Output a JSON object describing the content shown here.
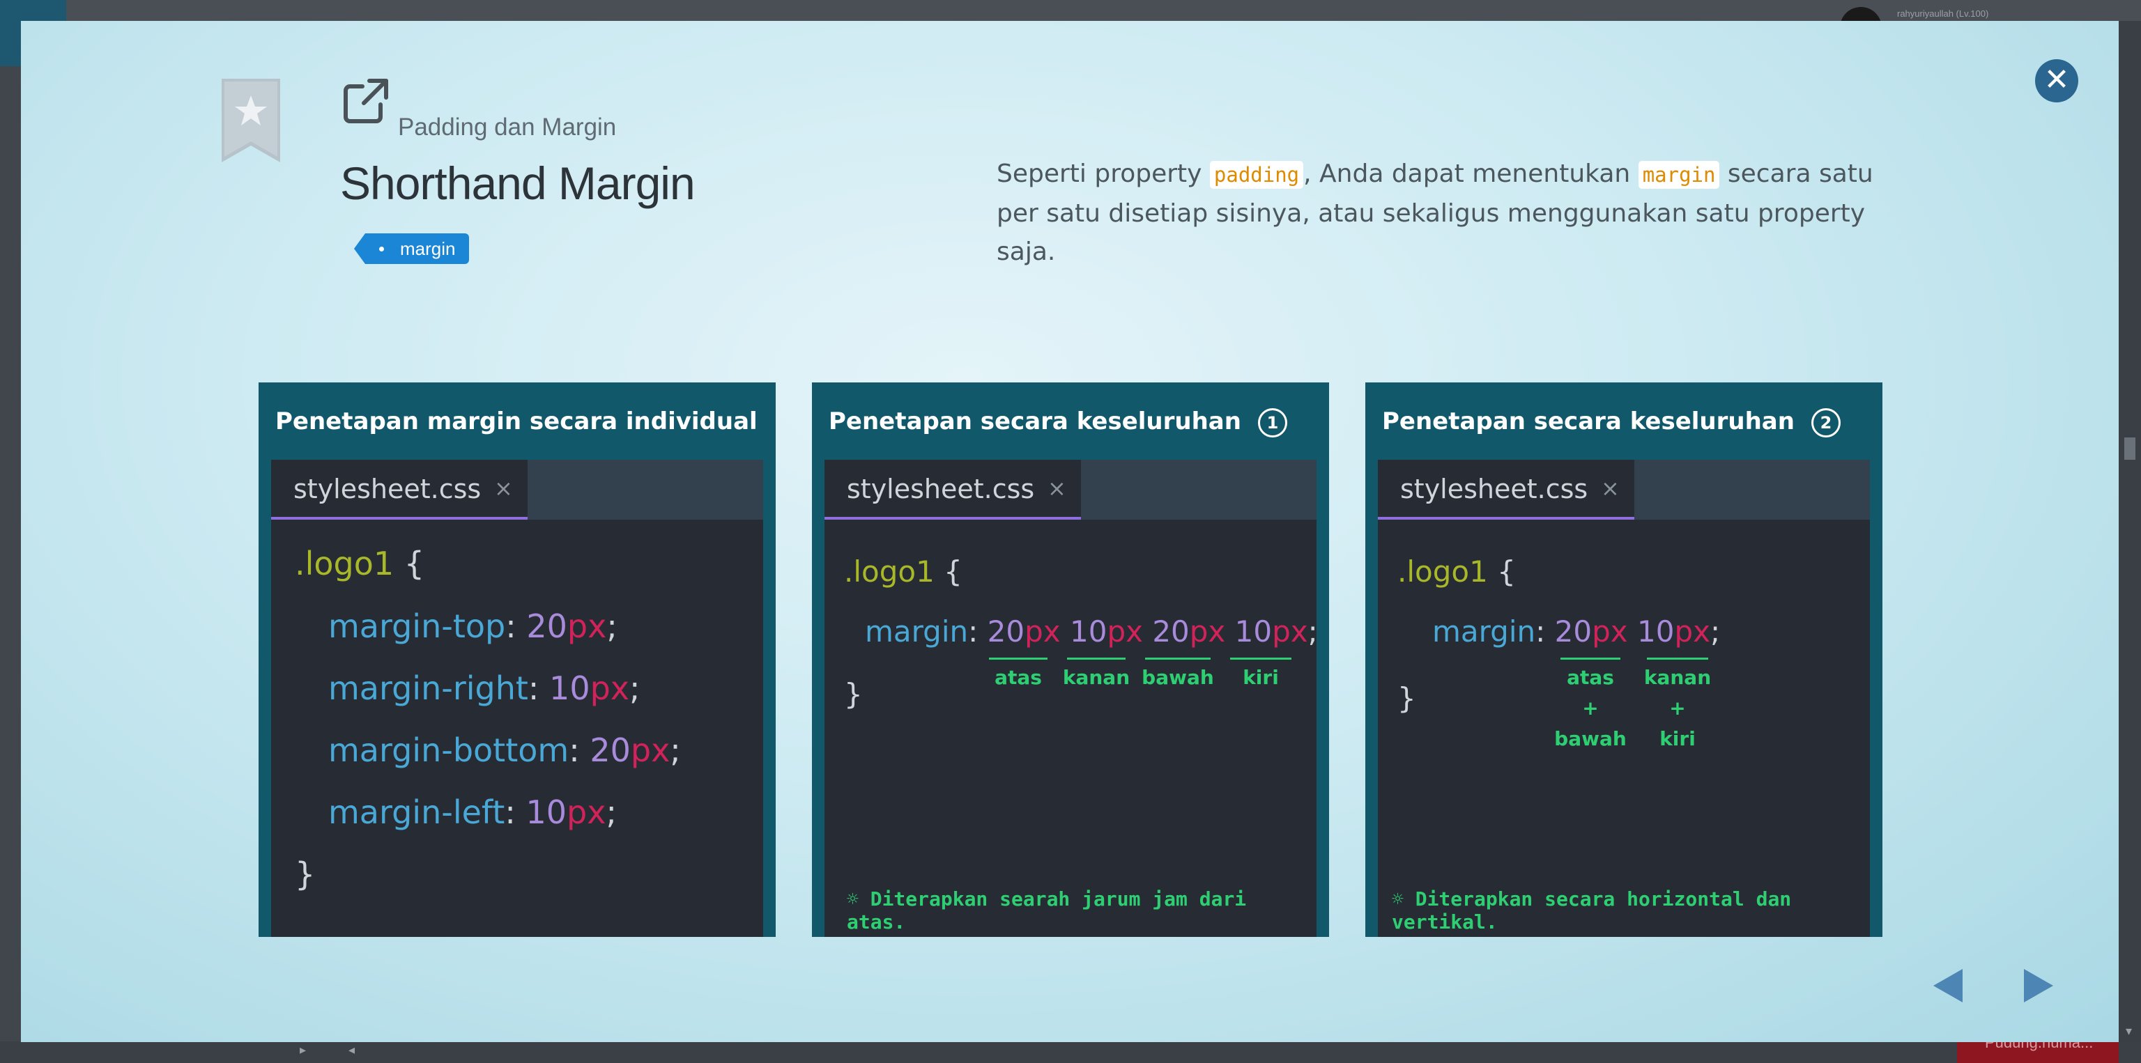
{
  "background": {
    "username": "rahyuriyaullah (Lv.100)",
    "bottom_button": "Pudung.numa..."
  },
  "modal": {
    "subtitle": "Padding dan Margin",
    "title": "Shorthand Margin",
    "tag": "margin",
    "description": {
      "part1": "Seperti property ",
      "code1": "padding",
      "part2": ", Anda dapat menentukan ",
      "code2": "margin",
      "part3": " secara satu per satu disetiap sisinya, atau sekaligus menggunakan satu property saja."
    }
  },
  "cards": [
    {
      "title": "Penetapan margin secara individual",
      "tab": "stylesheet.css",
      "tab_close": "×",
      "selector": ".logo1",
      "open": "{",
      "close": "}",
      "lines": [
        {
          "prop": "margin-top",
          "num": "20",
          "unit": "px"
        },
        {
          "prop": "margin-right",
          "num": "10",
          "unit": "px"
        },
        {
          "prop": "margin-bottom",
          "num": "20",
          "unit": "px"
        },
        {
          "prop": "margin-left",
          "num": "10",
          "unit": "px"
        }
      ]
    },
    {
      "title": "Penetapan secara keseluruhan",
      "badge": "1",
      "tab": "stylesheet.css",
      "tab_close": "×",
      "selector": ".logo1",
      "open": "{",
      "close": "}",
      "prop": "margin",
      "values": [
        {
          "num": "20",
          "unit": "px",
          "label": "atas"
        },
        {
          "num": "10",
          "unit": "px",
          "label": "kanan"
        },
        {
          "num": "20",
          "unit": "px",
          "label": "bawah"
        },
        {
          "num": "10",
          "unit": "px",
          "label": "kiri"
        }
      ],
      "note": "☼ Diterapkan searah jarum jam dari atas."
    },
    {
      "title": "Penetapan secara keseluruhan",
      "badge": "2",
      "tab": "stylesheet.css",
      "tab_close": "×",
      "selector": ".logo1",
      "open": "{",
      "close": "}",
      "prop": "margin",
      "values": [
        {
          "num": "20",
          "unit": "px",
          "label1": "atas",
          "plus": "+",
          "label2": "bawah"
        },
        {
          "num": "10",
          "unit": "px",
          "label1": "kanan",
          "plus": "+",
          "label2": "kiri"
        }
      ],
      "note": "☼ Diterapkan secara horizontal dan vertikal."
    }
  ],
  "colors": {
    "accent": "#1b86d6",
    "card_bg": "#11586a",
    "editor_bg": "#272c34",
    "annotation": "#2ecf72"
  }
}
